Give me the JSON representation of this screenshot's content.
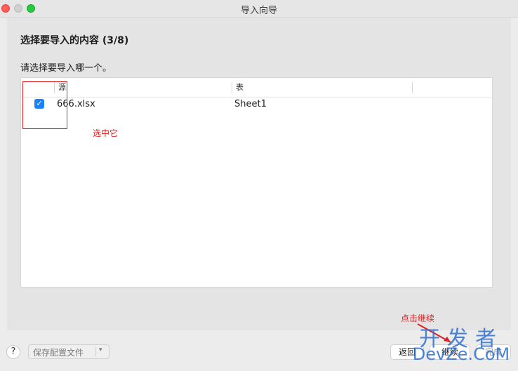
{
  "window": {
    "title": "导入向导"
  },
  "wizard": {
    "step_title": "选择要导入的内容 (3/8)",
    "question": "请选择要导入哪一个。"
  },
  "table": {
    "headers": [
      "源",
      "表"
    ],
    "rows": [
      {
        "checked": true,
        "source": "666.xlsx",
        "sheet": "Sheet1"
      }
    ]
  },
  "annotations": {
    "select_it": "选中它",
    "click_continue": "点击继续"
  },
  "footer": {
    "help": "?",
    "save_config": "保存配置文件",
    "back": "返回",
    "continue": "继续",
    "done": "完成"
  },
  "watermark": {
    "cn": "开发者",
    "en": "DevZe.CoM"
  },
  "colors": {
    "accent": "#1a82fb",
    "annotation": "#e02020",
    "watermark": "#2f6fd0"
  }
}
